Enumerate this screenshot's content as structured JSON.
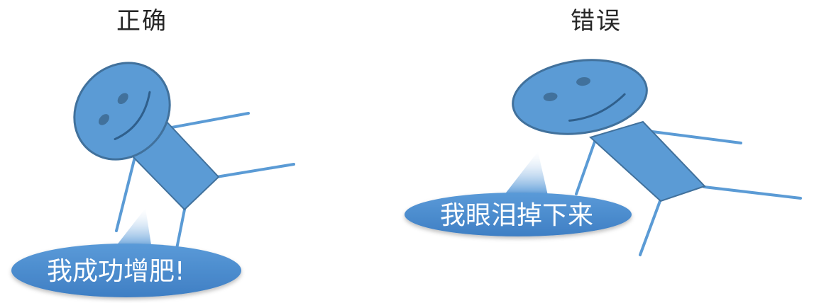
{
  "panels": {
    "left": {
      "title": "正确",
      "bubble_text": "我成功增肥!"
    },
    "right": {
      "title": "错误",
      "bubble_text": "我眼泪掉下来"
    }
  },
  "colors": {
    "figure_fill": "#5b9bd5",
    "figure_stroke": "#41719c",
    "face_stroke": "#2f5f8c",
    "bubble_fill": "#4a8bcf",
    "title_text": "#262626",
    "bubble_text": "#ffffff"
  }
}
